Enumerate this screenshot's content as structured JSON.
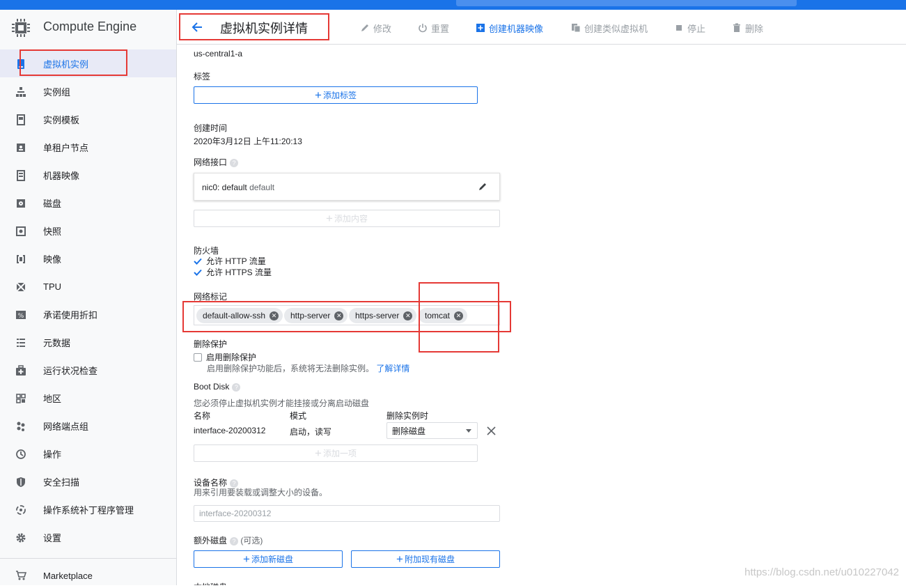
{
  "app": {
    "title": "Compute Engine"
  },
  "sidebar": {
    "items": [
      {
        "label": "虚拟机实例",
        "icon": "vm-instance-icon",
        "active": true
      },
      {
        "label": "实例组",
        "icon": "instance-group-icon"
      },
      {
        "label": "实例模板",
        "icon": "instance-template-icon"
      },
      {
        "label": "单租户节点",
        "icon": "sole-tenant-node-icon"
      },
      {
        "label": "机器映像",
        "icon": "machine-image-icon"
      },
      {
        "label": "磁盘",
        "icon": "disk-icon"
      },
      {
        "label": "快照",
        "icon": "snapshot-icon"
      },
      {
        "label": "映像",
        "icon": "image-icon"
      },
      {
        "label": "TPU",
        "icon": "tpu-icon"
      },
      {
        "label": "承诺使用折扣",
        "icon": "discount-icon"
      },
      {
        "label": "元数据",
        "icon": "metadata-icon"
      },
      {
        "label": "运行状况检查",
        "icon": "health-check-icon"
      },
      {
        "label": "地区",
        "icon": "zone-icon"
      },
      {
        "label": "网络端点组",
        "icon": "network-endpoint-group-icon"
      },
      {
        "label": "操作",
        "icon": "operations-icon"
      },
      {
        "label": "安全扫描",
        "icon": "security-scan-icon"
      },
      {
        "label": "操作系统补丁程序管理",
        "icon": "os-patch-icon"
      },
      {
        "label": "设置",
        "icon": "settings-icon"
      }
    ],
    "marketplace": "Marketplace"
  },
  "header": {
    "title": "虚拟机实例详情",
    "actions": {
      "edit": "修改",
      "reset": "重置",
      "create_image": "创建机器映像",
      "create_similar": "创建类似虚拟机",
      "stop": "停止",
      "delete": "删除"
    }
  },
  "details": {
    "zone": "us-central1-a",
    "labels_title": "标签",
    "add_label": "添加标签",
    "created_title": "创建时间",
    "created_value": "2020年3月12日 上午11:20:13",
    "network_interfaces_title": "网络接口",
    "nic_name": "nic0: default",
    "nic_network": "default",
    "add_item": "添加内容",
    "firewall_title": "防火墙",
    "allow_http": "允许 HTTP 流量",
    "allow_https": "允许 HTTPS 流量",
    "network_tags_title": "网络标记",
    "network_tags": [
      "default-allow-ssh",
      "http-server",
      "https-server",
      "tomcat"
    ],
    "deletion_protection_title": "删除保护",
    "enable_deletion_protection": "启用删除保护",
    "deletion_protection_desc": "启用删除保护功能后，系统将无法删除实例。",
    "learn_more": "了解详情",
    "boot_disk_title": "Boot Disk",
    "boot_disk_note": "您必须停止虚拟机实例才能挂接或分离启动磁盘",
    "col_name": "名称",
    "col_mode": "模式",
    "col_on_delete": "删除实例时",
    "disk_name": "interface-20200312",
    "disk_mode": "启动，读写",
    "disk_on_delete": "删除磁盘",
    "add_one": "添加一项",
    "device_name_title": "设备名称",
    "device_name_desc": "用来引用要装载或调整大小的设备。",
    "device_name_value": "interface-20200312",
    "extra_disks_title": "额外磁盘",
    "optional": "(可选)",
    "add_new_disk": "添加新磁盘",
    "attach_existing_disk": "附加现有磁盘",
    "next_section": "本地磁盘"
  },
  "watermark": "https://blog.csdn.net/u010227042",
  "colors": {
    "accent": "#1a73e8",
    "annotation": "#e53935"
  }
}
